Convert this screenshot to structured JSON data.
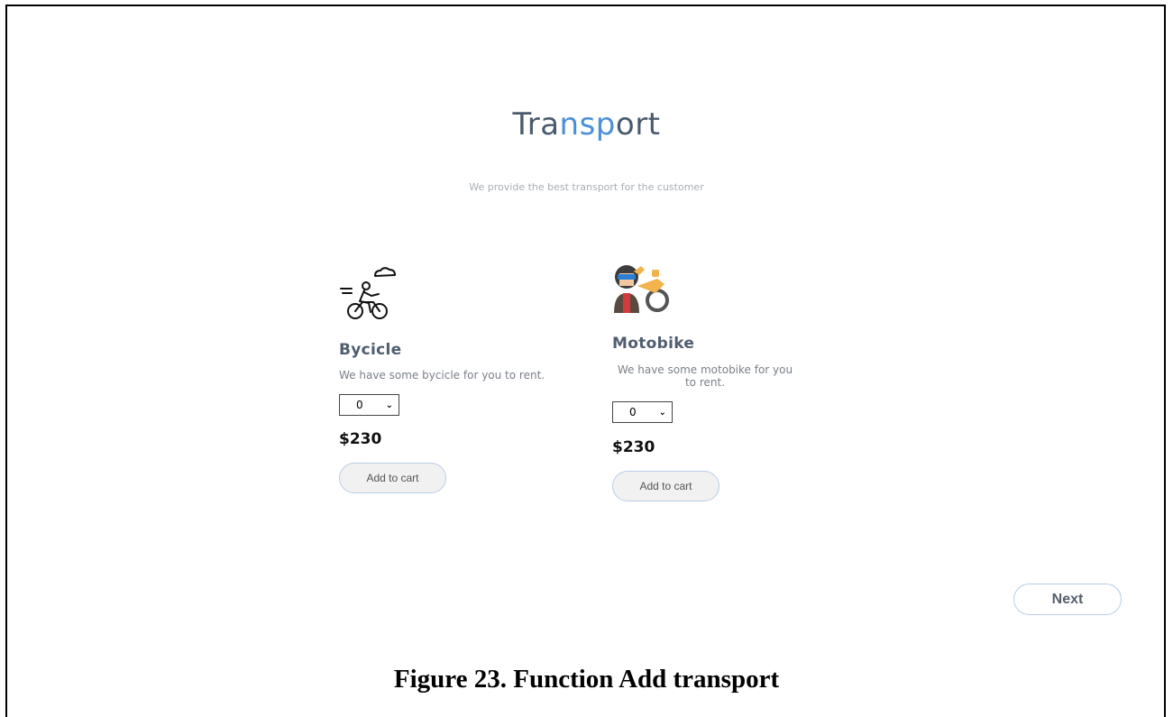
{
  "header": {
    "title_part1": "Tra",
    "title_part2": "nsp",
    "title_part3": "ort",
    "subtitle": "We provide the best transport for the customer"
  },
  "items": [
    {
      "name": "Bycicle",
      "icon": "cyclist-icon",
      "description": "We have some bycicle for you to rent.",
      "quantity": "0",
      "price": "$230",
      "button_label": "Add to cart"
    },
    {
      "name": "Motobike",
      "icon": "motorbike-rider-icon",
      "description": "We have some motobike for you to rent.",
      "quantity": "0",
      "price": "$230",
      "button_label": "Add to cart"
    }
  ],
  "next_label": "Next",
  "caption": "Figure 23. Function Add transport",
  "colors": {
    "title": "#4a5a6e",
    "title_highlight": "#4a90d9",
    "button_border": "#b8cde6"
  }
}
